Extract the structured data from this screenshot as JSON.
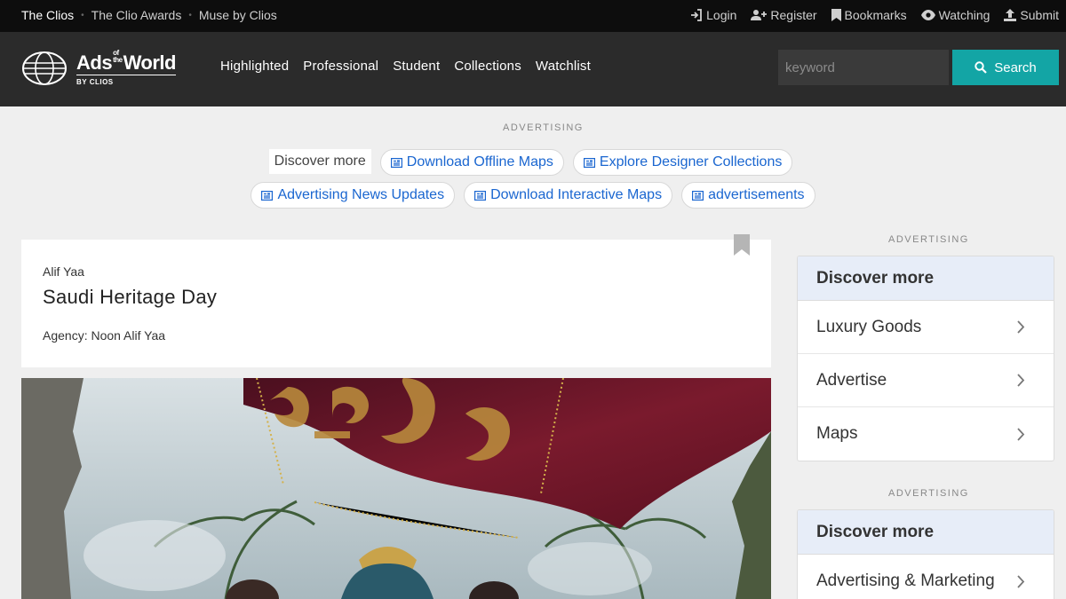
{
  "topbar": {
    "links": [
      "The Clios",
      "The Clio Awards",
      "Muse by Clios"
    ],
    "sep": "•",
    "actions": [
      {
        "label": "Login",
        "icon": "login-icon"
      },
      {
        "label": "Register",
        "icon": "register-icon"
      },
      {
        "label": "Bookmarks",
        "icon": "bookmark-icon"
      },
      {
        "label": "Watching",
        "icon": "eye-icon"
      },
      {
        "label": "Submit",
        "icon": "upload-icon"
      }
    ]
  },
  "header": {
    "logo": {
      "main": "Ads",
      "small_top": "of",
      "small_bottom": "the",
      "main2": "World",
      "sub": "BY CLIOS"
    },
    "nav": [
      "Highlighted",
      "Professional",
      "Student",
      "Collections",
      "Watchlist"
    ],
    "search": {
      "placeholder": "keyword",
      "button": "Search"
    },
    "accent": "#13a5a5"
  },
  "ad_top": {
    "label": "ADVERTISING",
    "discover": "Discover more",
    "row1": [
      "Download Offline Maps",
      "Explore Designer Collections"
    ],
    "row2": [
      "Advertising News Updates",
      "Download Interactive Maps",
      "advertisements"
    ]
  },
  "article": {
    "brand": "Alif Yaa",
    "title": "Saudi Heritage Day",
    "agency": "Agency: Noon Alif Yaa"
  },
  "sidebar": {
    "ad1": {
      "label": "ADVERTISING",
      "head": "Discover more",
      "items": [
        "Luxury Goods",
        "Advertise",
        "Maps"
      ]
    },
    "ad2": {
      "label": "ADVERTISING",
      "head": "Discover more",
      "items": [
        "Advertising & Marketing"
      ]
    }
  }
}
